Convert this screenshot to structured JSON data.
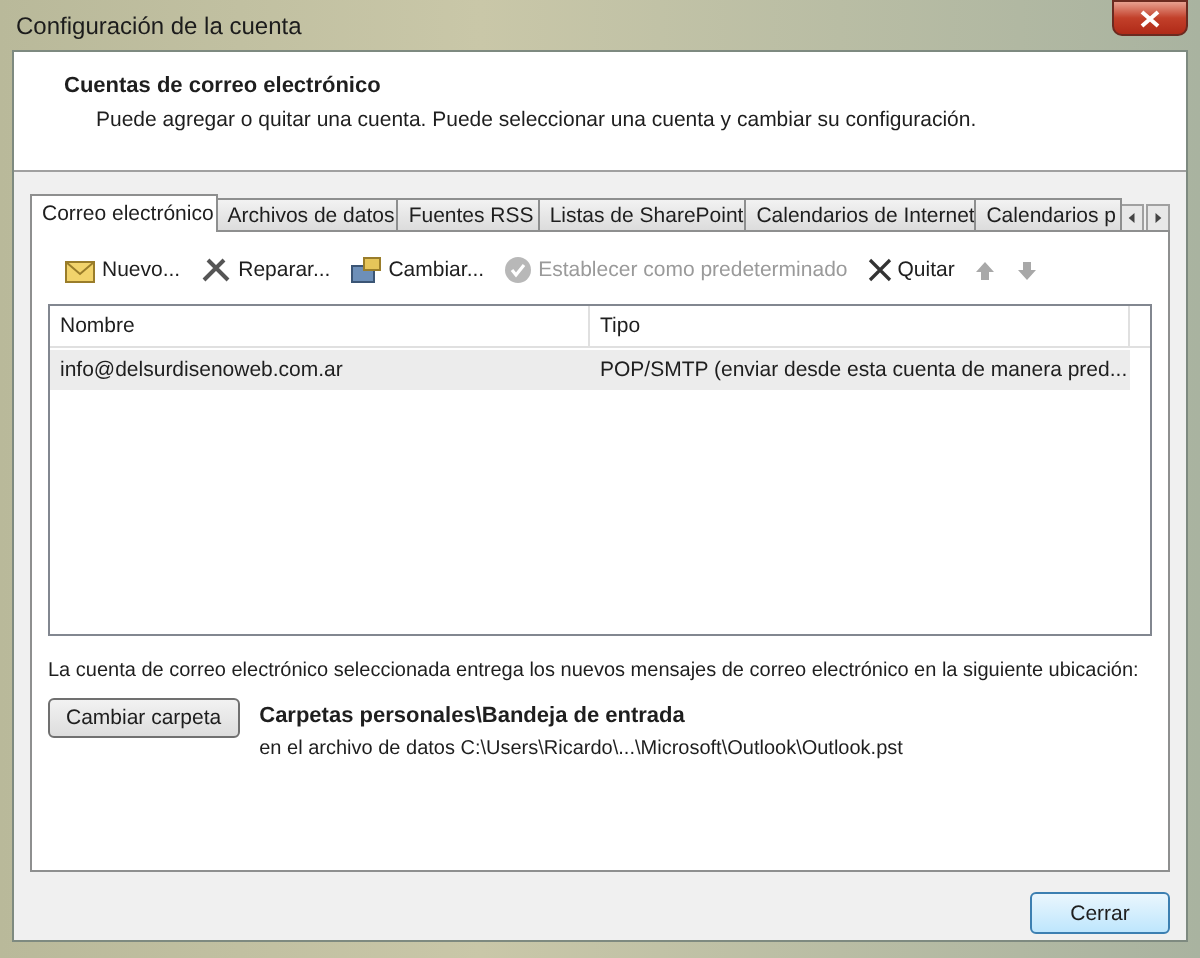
{
  "window": {
    "title": "Configuración de la cuenta"
  },
  "header": {
    "title": "Cuentas de correo electrónico",
    "subtitle": "Puede agregar o quitar una cuenta. Puede seleccionar una cuenta y cambiar su configuración."
  },
  "tabs": [
    {
      "label": "Correo electrónico",
      "selected": true
    },
    {
      "label": "Archivos de datos",
      "selected": false
    },
    {
      "label": "Fuentes RSS",
      "selected": false
    },
    {
      "label": "Listas de SharePoint",
      "selected": false
    },
    {
      "label": "Calendarios de Internet",
      "selected": false
    },
    {
      "label": "Calendarios p",
      "selected": false
    }
  ],
  "toolbar": [
    {
      "kind": "new",
      "label": "Nuevo...",
      "disabled": false
    },
    {
      "kind": "repair",
      "label": "Reparar...",
      "disabled": false
    },
    {
      "kind": "change",
      "label": "Cambiar...",
      "disabled": false
    },
    {
      "kind": "default",
      "label": "Establecer como predeterminado",
      "disabled": true
    },
    {
      "kind": "remove",
      "label": "Quitar",
      "disabled": false
    },
    {
      "kind": "up",
      "disabled": true
    },
    {
      "kind": "down",
      "disabled": true
    }
  ],
  "table": {
    "columns": [
      "Nombre",
      "Tipo"
    ],
    "rows": [
      {
        "cells": [
          "info@delsurdisenoweb.com.ar",
          "POP/SMTP (enviar desde esta cuenta de manera pred..."
        ],
        "selected": true
      }
    ]
  },
  "delivery": {
    "text": "La cuenta de correo electrónico seleccionada entrega los nuevos mensajes de correo electrónico en la siguiente ubicación:",
    "button": "Cambiar carpeta",
    "folder": "Carpetas personales\\Bandeja de entrada",
    "file": "en el archivo de datos C:\\Users\\Ricardo\\...\\Microsoft\\Outlook\\Outlook.pst"
  },
  "footer": {
    "button": "Cerrar"
  }
}
